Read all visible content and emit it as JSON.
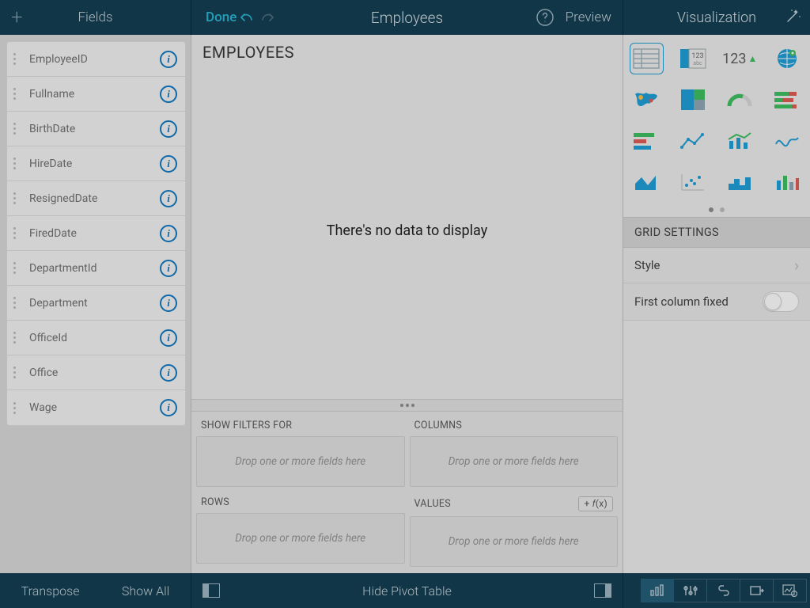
{
  "header": {
    "fields_title": "Fields",
    "done": "Done",
    "center_title": "Employees",
    "preview": "Preview",
    "viz_title": "Visualization"
  },
  "fields": [
    {
      "name": "EmployeeID"
    },
    {
      "name": "Fullname"
    },
    {
      "name": "BirthDate"
    },
    {
      "name": "HireDate"
    },
    {
      "name": "ResignedDate"
    },
    {
      "name": "FiredDate"
    },
    {
      "name": "DepartmentId"
    },
    {
      "name": "Department"
    },
    {
      "name": "OfficeId"
    },
    {
      "name": "Office"
    },
    {
      "name": "Wage"
    }
  ],
  "canvas": {
    "title": "EMPLOYEES",
    "nodata": "There's no data to display"
  },
  "pivot": {
    "filters_label": "SHOW FILTERS FOR",
    "columns_label": "COLUMNS",
    "rows_label": "ROWS",
    "values_label": "VALUES",
    "drop_hint": "Drop one or more fields here",
    "fx_label": "+ 𝑓(x)"
  },
  "viz": {
    "settings_title": "GRID SETTINGS",
    "style_label": "Style",
    "first_col_label": "First column fixed",
    "number_sample": "123"
  },
  "bottom": {
    "transpose": "Transpose",
    "show_all": "Show All",
    "hide_pivot": "Hide Pivot Table"
  }
}
